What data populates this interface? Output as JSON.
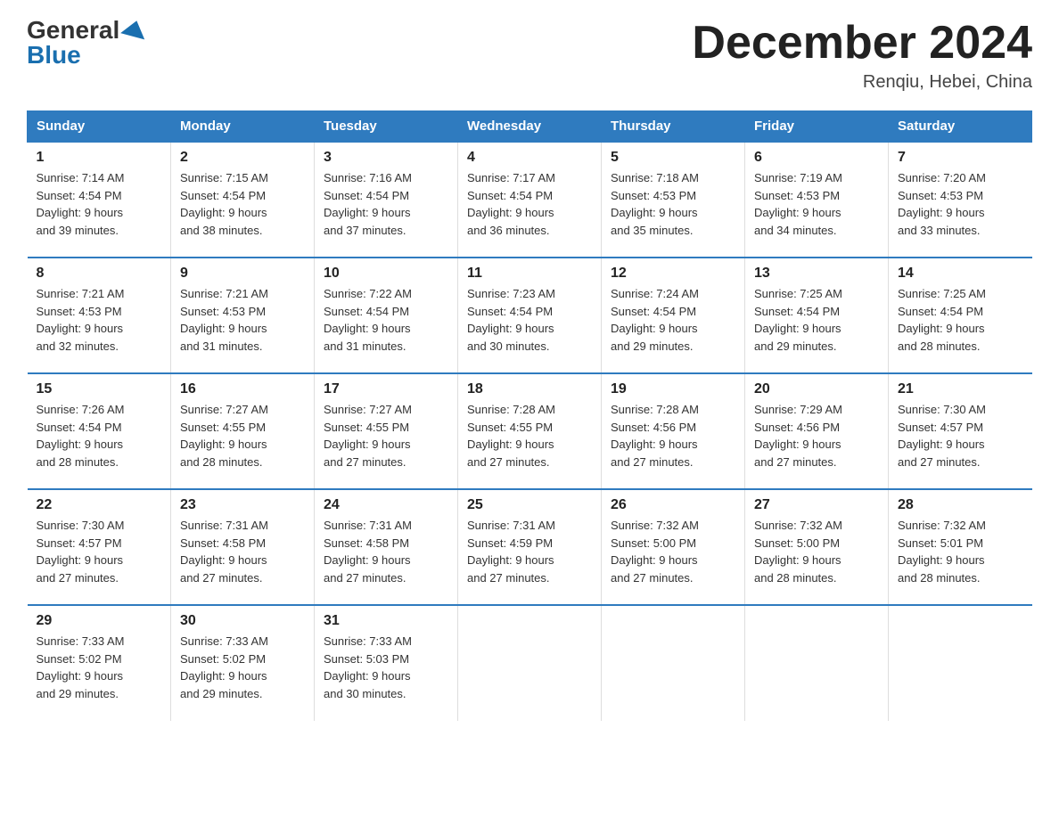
{
  "logo": {
    "general": "General",
    "triangle": "",
    "blue": "Blue"
  },
  "title": "December 2024",
  "location": "Renqiu, Hebei, China",
  "days_of_week": [
    "Sunday",
    "Monday",
    "Tuesday",
    "Wednesday",
    "Thursday",
    "Friday",
    "Saturday"
  ],
  "weeks": [
    [
      {
        "day": "1",
        "sunrise": "7:14 AM",
        "sunset": "4:54 PM",
        "daylight": "9 hours and 39 minutes."
      },
      {
        "day": "2",
        "sunrise": "7:15 AM",
        "sunset": "4:54 PM",
        "daylight": "9 hours and 38 minutes."
      },
      {
        "day": "3",
        "sunrise": "7:16 AM",
        "sunset": "4:54 PM",
        "daylight": "9 hours and 37 minutes."
      },
      {
        "day": "4",
        "sunrise": "7:17 AM",
        "sunset": "4:54 PM",
        "daylight": "9 hours and 36 minutes."
      },
      {
        "day": "5",
        "sunrise": "7:18 AM",
        "sunset": "4:53 PM",
        "daylight": "9 hours and 35 minutes."
      },
      {
        "day": "6",
        "sunrise": "7:19 AM",
        "sunset": "4:53 PM",
        "daylight": "9 hours and 34 minutes."
      },
      {
        "day": "7",
        "sunrise": "7:20 AM",
        "sunset": "4:53 PM",
        "daylight": "9 hours and 33 minutes."
      }
    ],
    [
      {
        "day": "8",
        "sunrise": "7:21 AM",
        "sunset": "4:53 PM",
        "daylight": "9 hours and 32 minutes."
      },
      {
        "day": "9",
        "sunrise": "7:21 AM",
        "sunset": "4:53 PM",
        "daylight": "9 hours and 31 minutes."
      },
      {
        "day": "10",
        "sunrise": "7:22 AM",
        "sunset": "4:54 PM",
        "daylight": "9 hours and 31 minutes."
      },
      {
        "day": "11",
        "sunrise": "7:23 AM",
        "sunset": "4:54 PM",
        "daylight": "9 hours and 30 minutes."
      },
      {
        "day": "12",
        "sunrise": "7:24 AM",
        "sunset": "4:54 PM",
        "daylight": "9 hours and 29 minutes."
      },
      {
        "day": "13",
        "sunrise": "7:25 AM",
        "sunset": "4:54 PM",
        "daylight": "9 hours and 29 minutes."
      },
      {
        "day": "14",
        "sunrise": "7:25 AM",
        "sunset": "4:54 PM",
        "daylight": "9 hours and 28 minutes."
      }
    ],
    [
      {
        "day": "15",
        "sunrise": "7:26 AM",
        "sunset": "4:54 PM",
        "daylight": "9 hours and 28 minutes."
      },
      {
        "day": "16",
        "sunrise": "7:27 AM",
        "sunset": "4:55 PM",
        "daylight": "9 hours and 28 minutes."
      },
      {
        "day": "17",
        "sunrise": "7:27 AM",
        "sunset": "4:55 PM",
        "daylight": "9 hours and 27 minutes."
      },
      {
        "day": "18",
        "sunrise": "7:28 AM",
        "sunset": "4:55 PM",
        "daylight": "9 hours and 27 minutes."
      },
      {
        "day": "19",
        "sunrise": "7:28 AM",
        "sunset": "4:56 PM",
        "daylight": "9 hours and 27 minutes."
      },
      {
        "day": "20",
        "sunrise": "7:29 AM",
        "sunset": "4:56 PM",
        "daylight": "9 hours and 27 minutes."
      },
      {
        "day": "21",
        "sunrise": "7:30 AM",
        "sunset": "4:57 PM",
        "daylight": "9 hours and 27 minutes."
      }
    ],
    [
      {
        "day": "22",
        "sunrise": "7:30 AM",
        "sunset": "4:57 PM",
        "daylight": "9 hours and 27 minutes."
      },
      {
        "day": "23",
        "sunrise": "7:31 AM",
        "sunset": "4:58 PM",
        "daylight": "9 hours and 27 minutes."
      },
      {
        "day": "24",
        "sunrise": "7:31 AM",
        "sunset": "4:58 PM",
        "daylight": "9 hours and 27 minutes."
      },
      {
        "day": "25",
        "sunrise": "7:31 AM",
        "sunset": "4:59 PM",
        "daylight": "9 hours and 27 minutes."
      },
      {
        "day": "26",
        "sunrise": "7:32 AM",
        "sunset": "5:00 PM",
        "daylight": "9 hours and 27 minutes."
      },
      {
        "day": "27",
        "sunrise": "7:32 AM",
        "sunset": "5:00 PM",
        "daylight": "9 hours and 28 minutes."
      },
      {
        "day": "28",
        "sunrise": "7:32 AM",
        "sunset": "5:01 PM",
        "daylight": "9 hours and 28 minutes."
      }
    ],
    [
      {
        "day": "29",
        "sunrise": "7:33 AM",
        "sunset": "5:02 PM",
        "daylight": "9 hours and 29 minutes."
      },
      {
        "day": "30",
        "sunrise": "7:33 AM",
        "sunset": "5:02 PM",
        "daylight": "9 hours and 29 minutes."
      },
      {
        "day": "31",
        "sunrise": "7:33 AM",
        "sunset": "5:03 PM",
        "daylight": "9 hours and 30 minutes."
      },
      null,
      null,
      null,
      null
    ]
  ],
  "labels": {
    "sunrise": "Sunrise:",
    "sunset": "Sunset:",
    "daylight": "Daylight:"
  }
}
